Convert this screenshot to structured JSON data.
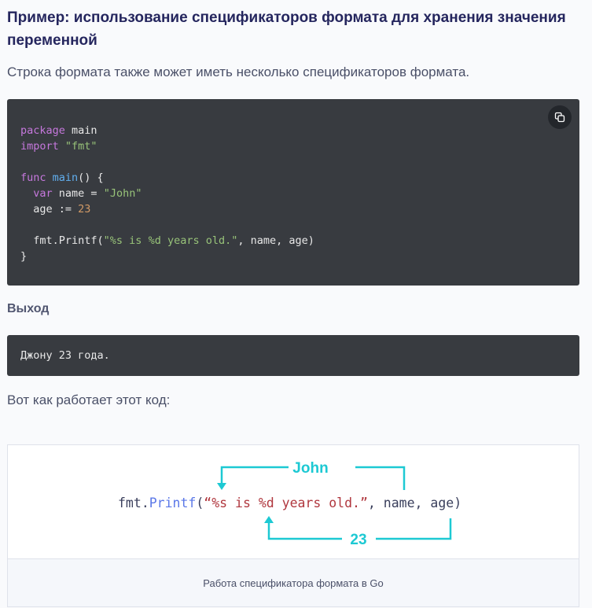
{
  "heading": "Пример: использование спецификаторов формата для хранения значения переменной",
  "intro": "Строка формата также может иметь несколько спецификаторов формата.",
  "code": {
    "copy_icon": "copy-icon",
    "line1_kw": "package",
    "line1_rest": " main",
    "line2_kw": "import",
    "line2_str": "\"fmt\"",
    "line4_kw": "func",
    "line4_fn": "main",
    "line4_rest": "() {",
    "line5_kw": "var",
    "line5_mid": " name = ",
    "line5_str": "\"John\"",
    "line6_mid": "age := ",
    "line6_num": "23",
    "line8_pre": "fmt.Printf(",
    "line8_str": "\"%s is %d years old.\"",
    "line8_rest": ", name, age)",
    "line9": "}"
  },
  "output_label": "Выход",
  "output_text": "Джону 23 года.",
  "explain": "Вот как работает этот код:",
  "figure": {
    "top_label": "John",
    "bottom_label": "23",
    "code_obj": "fmt",
    "code_dot": ".",
    "code_fn": "Printf",
    "code_open": "(",
    "code_str": "“%s is %d years old.”",
    "code_rest": ", name, age)",
    "caption": "Работа спецификатора формата в Go",
    "arrow_color": "#1dc9d3",
    "string_color": "#b0373e",
    "fn_color": "#5b78e8"
  }
}
